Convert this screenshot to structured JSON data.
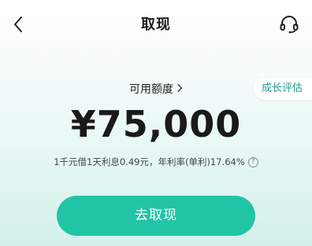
{
  "header": {
    "title": "取现",
    "back_icon": "chevron-left-icon",
    "service_icon": "headset-icon"
  },
  "growth_badge": {
    "label": "成长评估"
  },
  "quota": {
    "label": "可用额度"
  },
  "amount": "¥75,000",
  "rate_info": "1千元借1天利息0.49元，年利率(单利)17.64%",
  "withdraw_button": {
    "label": "去取现"
  },
  "colors": {
    "accent": "#22c4a6",
    "badge_text": "#1a9f8a"
  }
}
